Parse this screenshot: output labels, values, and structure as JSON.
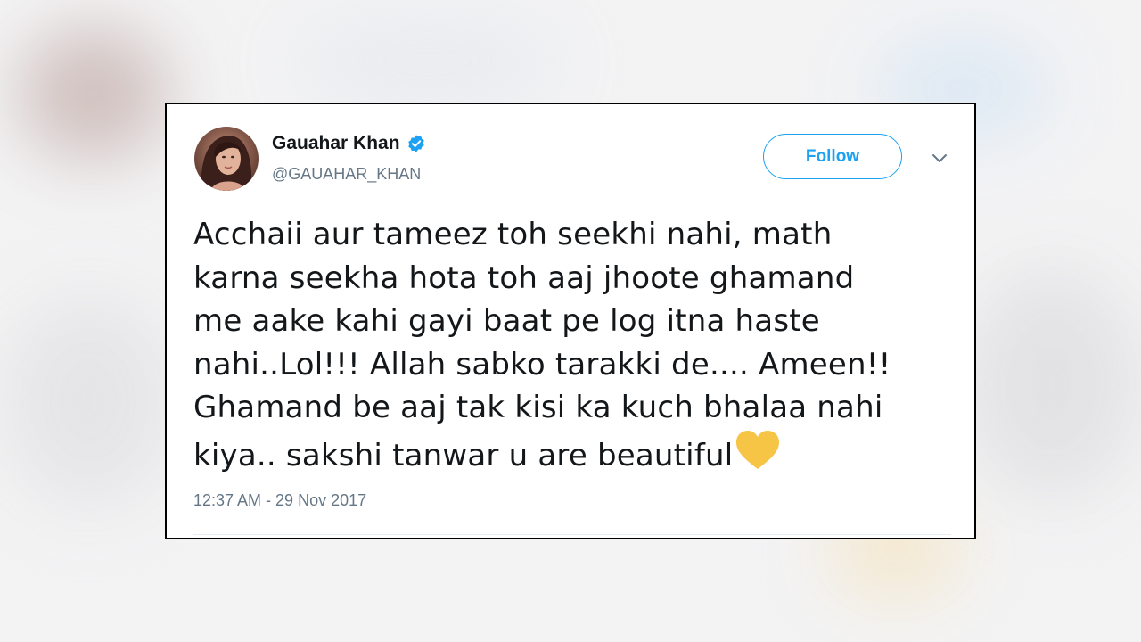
{
  "tweet": {
    "author_name": "Gauahar Khan",
    "handle": "@GAUAHAR_KHAN",
    "follow_label": "Follow",
    "text": "Acchaii aur tameez toh seekhi nahi, math\nkarna seekha hota toh aaj jhoote ghamand\nme aake kahi gayi baat pe log itna haste\nnahi..Lol!!! Allah sabko tarakki de.... Ameen!!\nGhamand be aaj tak kisi ka kuch bhalaa nahi\nkiya.. sakshi tanwar u are beautiful",
    "emoji": "yellow-heart-emoji",
    "timestamp": "12:37 AM - 29 Nov 2017"
  },
  "icons": {
    "verified": "verified-badge-icon",
    "caret": "chevron-down-icon",
    "avatar": "profile-avatar"
  },
  "colors": {
    "accent": "#1da1f2",
    "text": "#14171a",
    "secondary_text": "#657786",
    "heart": "#f6c545"
  }
}
